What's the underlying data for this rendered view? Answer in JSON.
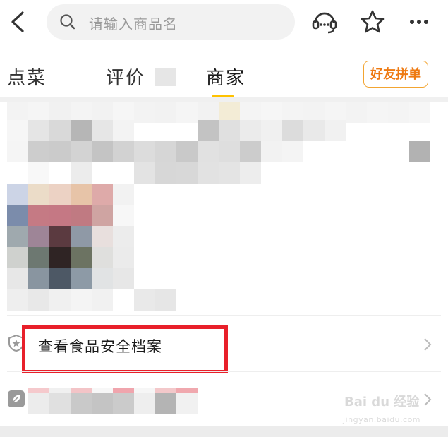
{
  "search": {
    "placeholder": "请输入商品名"
  },
  "tabs": [
    {
      "label": "点菜",
      "active": false
    },
    {
      "label": "评价",
      "active": false
    },
    {
      "label": "商家",
      "active": true
    }
  ],
  "friend_button": {
    "label": "好友拼单"
  },
  "rows": [
    {
      "label": "查看食品安全档案",
      "icon": "shield-star-icon"
    }
  ],
  "colors": {
    "accent": "#ffc200",
    "friend_btn_border": "#f3a531",
    "highlight_box": "#e8202a"
  },
  "watermark": {
    "brand": "Bai du 经验",
    "url": "jingyan.baidu.com"
  }
}
